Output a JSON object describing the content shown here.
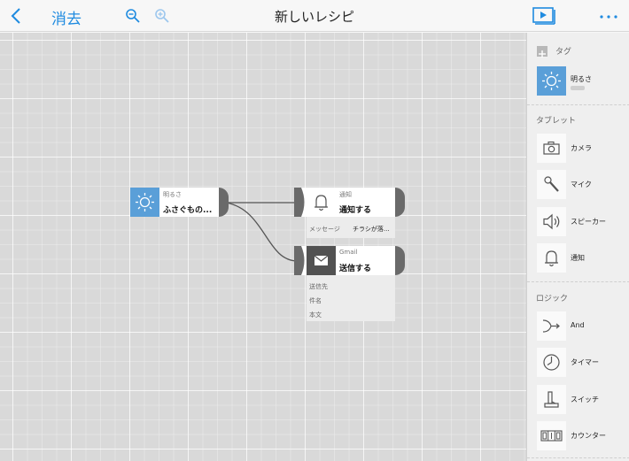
{
  "toolbar": {
    "delete_label": "消去",
    "title": "新しいレシピ",
    "more_label": "···"
  },
  "canvas": {
    "nodes": [
      {
        "id": "brightness",
        "label": "明るさ",
        "value": "ふさぐもの..."
      },
      {
        "id": "notify",
        "label": "通知",
        "value": "通知する",
        "params": [
          {
            "name": "メッセージ",
            "value": "チラシが落..."
          }
        ]
      },
      {
        "id": "gmail",
        "label": "Gmail",
        "value": "送信する",
        "params": [
          {
            "name": "送信先",
            "value": ""
          },
          {
            "name": "件名",
            "value": ""
          },
          {
            "name": "本文",
            "value": ""
          }
        ]
      }
    ]
  },
  "sidebar": {
    "tag_header": "タグ",
    "tag_item": {
      "label": "明るさ",
      "icon": "brightness-icon"
    },
    "tablet": {
      "title": "タブレット",
      "items": [
        {
          "label": "カメラ",
          "icon": "camera-icon"
        },
        {
          "label": "マイク",
          "icon": "microphone-icon"
        },
        {
          "label": "スピーカー",
          "icon": "speaker-icon"
        },
        {
          "label": "通知",
          "icon": "bell-icon"
        }
      ]
    },
    "logic": {
      "title": "ロジック",
      "items": [
        {
          "label": "And",
          "icon": "merge-arrow-icon"
        },
        {
          "label": "タイマー",
          "icon": "timer-icon"
        },
        {
          "label": "スイッチ",
          "icon": "switch-icon"
        },
        {
          "label": "カウンター",
          "icon": "counter-icon"
        }
      ]
    }
  },
  "colors": {
    "accent": "#1f8be0",
    "node_blue": "#5a9fd8",
    "node_dark": "#525252",
    "canvas_bg": "#d9d9d9"
  }
}
